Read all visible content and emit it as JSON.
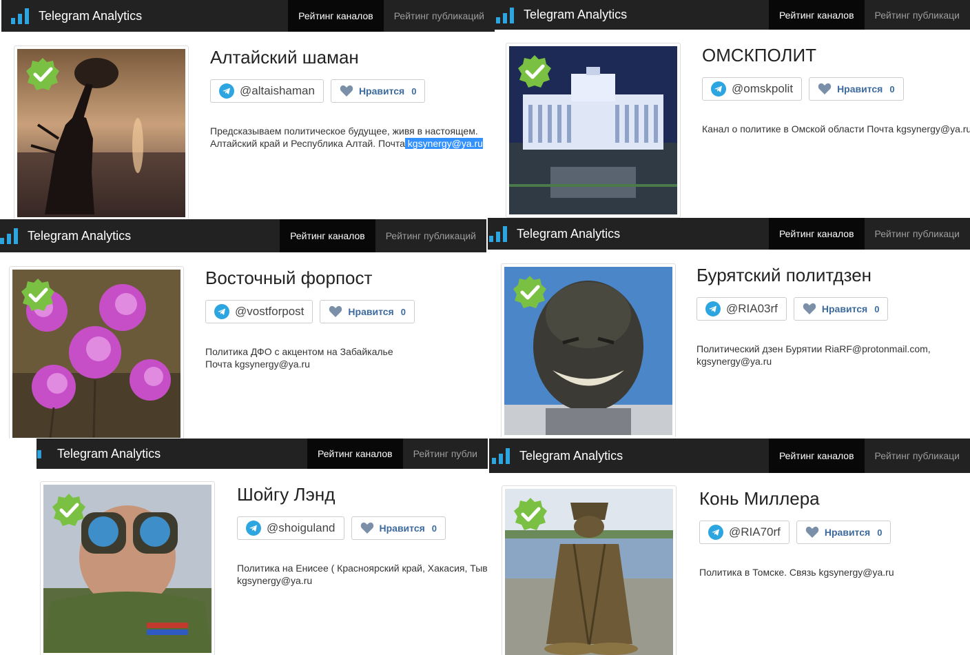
{
  "app": {
    "brand": "Telegram Analytics",
    "tab_channels": "Рейтинг каналов",
    "tab_posts": "Рейтинг публикаций",
    "tab_posts_cut_1": "Рейтинг публикаци",
    "tab_posts_cut_2": "Рейтинг публи"
  },
  "colors": {
    "navbar": "#222222",
    "active_tab": "#080808",
    "telegram": "#2ca5e0",
    "verified": "#7ac143",
    "like": "#3c6a9e",
    "selection": "#3390ff"
  },
  "channels": [
    {
      "title": "Алтайский шаман",
      "handle": "@altaishaman",
      "like_label": "Нравится",
      "likes": "0",
      "desc_1": "Предсказываем политическое будущее, живя в настоящем.",
      "desc_2": "Алтайский край и Республика Алтай. Почта",
      "desc_sel": " kgsynergy@ya.ru"
    },
    {
      "title": "ОМСКПОЛИТ",
      "handle": "@omskpolit",
      "like_label": "Нравится",
      "likes": "0",
      "desc_1": "Канал о политике в Омской области Почта kgsynergy@ya.ru"
    },
    {
      "title": "Восточный форпост",
      "handle": "@vostforpost",
      "like_label": "Нравится",
      "likes": "0",
      "desc_1": "Политика ДФО с акцентом на Забайкалье",
      "desc_2": "Почта kgsynergy@ya.ru"
    },
    {
      "title": "Бурятский политдзен",
      "handle": "@RIA03rf",
      "like_label": "Нравится",
      "likes": "0",
      "desc_1": "Политический дзен Бурятии RiaRF@protonmail.com,",
      "desc_2": "kgsynergy@ya.ru"
    },
    {
      "title": "Шойгу Лэнд",
      "handle": "@shoiguland",
      "like_label": "Нравится",
      "likes": "0",
      "desc_1": "Политика на Енисее ( Красноярский край, Хакасия, Тыва",
      "desc_2": "kgsynergy@ya.ru"
    },
    {
      "title": "Конь Миллера",
      "handle": "@RIA70rf",
      "like_label": "Нравится",
      "likes": "0",
      "desc_1": "Политика в Томске. Связь kgsynergy@ya.ru"
    }
  ]
}
